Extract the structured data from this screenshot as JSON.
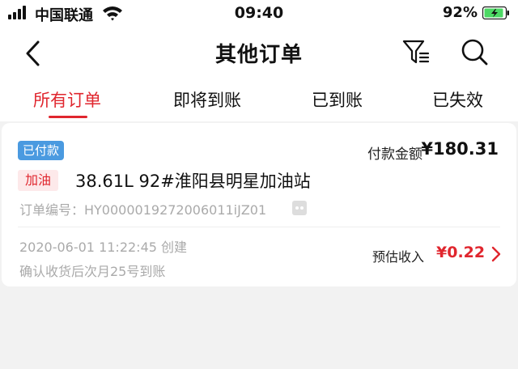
{
  "status_bar": {
    "carrier": "中国联通",
    "time": "09:40",
    "battery_percent": "92%",
    "battery_level": 0.92
  },
  "nav": {
    "title": "其他订单",
    "icons": [
      "back-icon",
      "filter-icon",
      "search-icon"
    ]
  },
  "tabs": [
    {
      "label": "所有订单",
      "active": true
    },
    {
      "label": "即将到账",
      "active": false
    },
    {
      "label": "已到账",
      "active": false
    },
    {
      "label": "已失效",
      "active": false
    }
  ],
  "order": {
    "status_badge": "已付款",
    "amount_label": "付款金额",
    "amount_value": "¥180.31",
    "category_tag": "加油",
    "product": "38.61L 92#淮阳县明星加油站",
    "order_number": "订单编号：HY0000019272006011iJZ01",
    "created": "2020-06-01 11:22:45 创建",
    "settle_note": "确认收货后次月25号到账",
    "income_label": "预估收入",
    "income_value": "¥0.22"
  },
  "colors": {
    "accent_red": "#e0262e",
    "badge_blue": "#4a9ae0",
    "battery_green": "#4cd964",
    "background": "#f2f2f2"
  }
}
